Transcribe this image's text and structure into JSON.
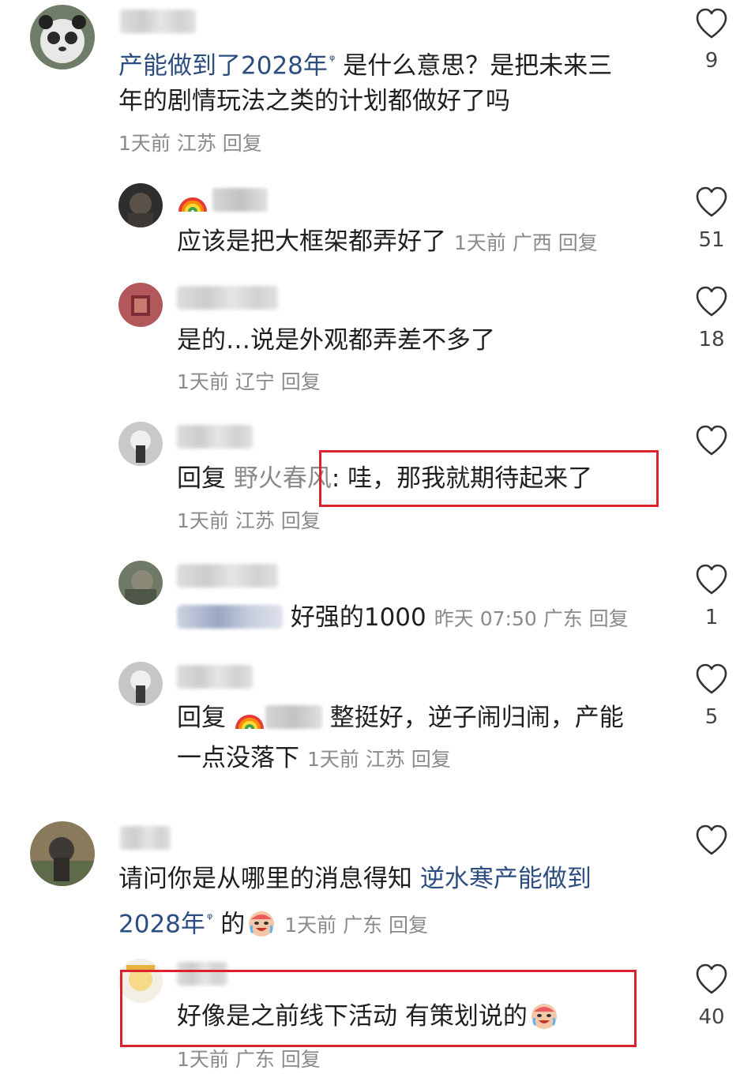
{
  "comments": [
    {
      "text_pre": "产能做到了2028年",
      "text_mid": "是什么意思？是把未来三",
      "text_line2": "年的剧情玩法之类的计划都做好了吗",
      "meta": "1天前 江苏 回复",
      "likes": "9"
    },
    {
      "text": "应该是把大框架都弄好了",
      "meta": "1天前 广西 回复",
      "likes": "51"
    },
    {
      "name": "野火春风",
      "text": "是的…说是外观都弄差不多了",
      "meta": "1天前 辽宁 回复",
      "likes": "18"
    },
    {
      "reply_prefix": "回复",
      "reply_target": "野火春风",
      "text": ": 哇，那我就期待起来了",
      "meta": "1天前 江苏 回复"
    },
    {
      "text": "好强的1000",
      "meta": "昨天 07:50 广东 回复",
      "likes": "1"
    },
    {
      "reply_prefix": "回复",
      "text": "整挺好，逆子闹归闹，产能",
      "text_line2": "一点没落下",
      "meta": "1天前 江苏 回复",
      "likes": "5"
    },
    {
      "text": "请问你是从哪里的消息得知",
      "link": "逆水寒产能做到",
      "link_line2": "2028年",
      "text_after": "的",
      "meta": "1天前 广东 回复"
    },
    {
      "text": "好像是之前线下活动 有策划说的",
      "meta": "1天前 广东 回复",
      "likes": "40"
    }
  ],
  "colors": {
    "highlight_box": "#d9232e",
    "link_text": "#2c4d80",
    "meta_text": "#8a8a8a"
  },
  "icons": [
    "heart-icon",
    "search-mark-icon",
    "laugh-cry-emoji-icon",
    "rainbow-icon"
  ]
}
